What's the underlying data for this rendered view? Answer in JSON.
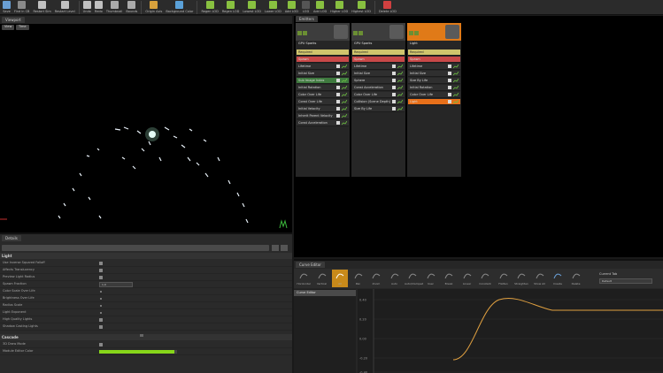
{
  "toolbar": {
    "items": [
      {
        "label": "Save",
        "icon": "save-icon",
        "color": "#6a9fd4"
      },
      {
        "label": "Find in CB",
        "icon": "find-in-browser-icon",
        "color": "#8a8a8a"
      },
      {
        "label": "Restart Sim",
        "icon": "restart-sim-icon",
        "color": "#c0c0c0"
      },
      {
        "label": "Restart Level",
        "icon": "restart-level-icon",
        "color": "#c0c0c0"
      },
      {
        "label": "Undo",
        "icon": "undo-icon",
        "color": "#c0c0c0"
      },
      {
        "label": "Redo",
        "icon": "redo-icon",
        "color": "#c0c0c0"
      },
      {
        "label": "Thumbnail",
        "icon": "thumbnail-icon",
        "color": "#aaaaaa"
      },
      {
        "label": "Bounds",
        "icon": "bounds-icon",
        "color": "#aaaaaa"
      },
      {
        "label": "Origin Axis",
        "icon": "origin-axis-icon",
        "color": "#d8a13c"
      },
      {
        "label": "Background Color",
        "icon": "background-color-icon",
        "color": "#5aa0d8"
      },
      {
        "label": "Regen LOD",
        "icon": "regen-lod-icon",
        "color": "#88c040"
      },
      {
        "label": "Regen LOD",
        "icon": "regen-lod-all-icon",
        "color": "#88c040"
      },
      {
        "label": "Lowest LOD",
        "icon": "lowest-lod-icon",
        "color": "#88c040"
      },
      {
        "label": "Lower LOD",
        "icon": "lower-lod-icon",
        "color": "#88c040"
      },
      {
        "label": "Add LOD",
        "icon": "add-lod-before-icon",
        "color": "#88c040"
      },
      {
        "label": "LOD",
        "icon": "lod-field-icon",
        "color": "#555555"
      },
      {
        "label": "Add LOD",
        "icon": "add-lod-after-icon",
        "color": "#88c040"
      },
      {
        "label": "Higher LOD",
        "icon": "higher-lod-icon",
        "color": "#88c040"
      },
      {
        "label": "Highest LOD",
        "icon": "highest-lod-icon",
        "color": "#88c040"
      },
      {
        "label": "Delete LOD",
        "icon": "delete-lod-icon",
        "color": "#d04040"
      }
    ]
  },
  "viewport": {
    "tab": "Viewport",
    "buttons": [
      "View",
      "Time"
    ]
  },
  "details": {
    "tab": "Details",
    "sections": [
      {
        "name": "Light",
        "rows": [
          {
            "label": "Use Inverse Squared Falloff",
            "kind": "check"
          },
          {
            "label": "Affects Translucency",
            "kind": "check"
          },
          {
            "label": "Preview Light Radius",
            "kind": "check"
          },
          {
            "label": "Spawn Fraction",
            "kind": "combo",
            "value": "1.0"
          },
          {
            "label": "Color Scale Over Life",
            "kind": "dot"
          },
          {
            "label": "Brightness Over Life",
            "kind": "dot"
          },
          {
            "label": "Radius Scale",
            "kind": "dot"
          },
          {
            "label": "Light Exponent",
            "kind": "dot"
          },
          {
            "label": "High Quality Lights",
            "kind": "check"
          },
          {
            "label": "Shadow Casting Lights",
            "kind": "check"
          }
        ]
      },
      {
        "name": "Cascade",
        "rows": [
          {
            "label": "3D Draw Mode",
            "kind": "check"
          },
          {
            "label": "Module Editor Color",
            "kind": "bar",
            "value": 0.97
          }
        ]
      }
    ]
  },
  "emitters": {
    "tab": "Emitters",
    "columns": [
      {
        "title": "GPU Sparks",
        "header_color": "#3d3d3d",
        "modules": [
          {
            "label": "Required",
            "color": "#cfc46c"
          },
          {
            "label": "Spawn",
            "color": "#c84848"
          },
          {
            "label": "Lifetime",
            "color": "#2f2f2f"
          },
          {
            "label": "Initial Size",
            "color": "#2f2f2f"
          },
          {
            "label": "Sub Image Index",
            "color": "#3f7a3f"
          },
          {
            "label": "Initial Rotation",
            "color": "#2f2f2f"
          },
          {
            "label": "Color Over Life",
            "color": "#2f2f2f"
          },
          {
            "label": "Const Over Life",
            "color": "#2f2f2f"
          },
          {
            "label": "Initial Velocity",
            "color": "#2f2f2f"
          },
          {
            "label": "Inherit Parent Velocity",
            "color": "#2f2f2f"
          },
          {
            "label": "Const Acceleration",
            "color": "#2f2f2f"
          }
        ]
      },
      {
        "title": "GPU Sparks",
        "header_color": "#3d3d3d",
        "modules": [
          {
            "label": "Required",
            "color": "#cfc46c"
          },
          {
            "label": "Spawn",
            "color": "#c84848"
          },
          {
            "label": "Lifetime",
            "color": "#2f2f2f"
          },
          {
            "label": "Initial Size",
            "color": "#2f2f2f"
          },
          {
            "label": "Sphere",
            "color": "#2f2f2f"
          },
          {
            "label": "Const Acceleration",
            "color": "#2f2f2f"
          },
          {
            "label": "Color Over Life",
            "color": "#2f2f2f"
          },
          {
            "label": "Collision (Scene Depth)",
            "color": "#2f2f2f"
          },
          {
            "label": "Size By Life",
            "color": "#2f2f2f"
          }
        ]
      },
      {
        "title": "Light",
        "header_color": "#e07a18",
        "modules": [
          {
            "label": "Required",
            "color": "#cfc46c"
          },
          {
            "label": "Spawn",
            "color": "#c84848"
          },
          {
            "label": "Lifetime",
            "color": "#2f2f2f"
          },
          {
            "label": "Initial Size",
            "color": "#2f2f2f"
          },
          {
            "label": "Size By Life",
            "color": "#2f2f2f"
          },
          {
            "label": "Initial Rotation",
            "color": "#2f2f2f"
          },
          {
            "label": "Color Over Life",
            "color": "#2f2f2f"
          },
          {
            "label": "Light",
            "color": "#e8701a"
          }
        ]
      }
    ]
  },
  "curve_editor": {
    "tab": "Curve Editor",
    "buttons": [
      "Horizontal",
      "Vertical",
      "All",
      "Pan",
      "Zoom",
      "Auto",
      "Auto/Clamped",
      "User",
      "Break",
      "Linear",
      "Constant",
      "Flatten",
      "Straighten",
      "Show All",
      "Create",
      "Delete"
    ],
    "preset_label": "Current Tab",
    "preset_value": "Default",
    "track": "Curve Editor",
    "y_labels": [
      "0.40",
      "0.20",
      "0.00",
      "-0.20",
      "-0.40"
    ],
    "curve_color": "#e0a040"
  }
}
